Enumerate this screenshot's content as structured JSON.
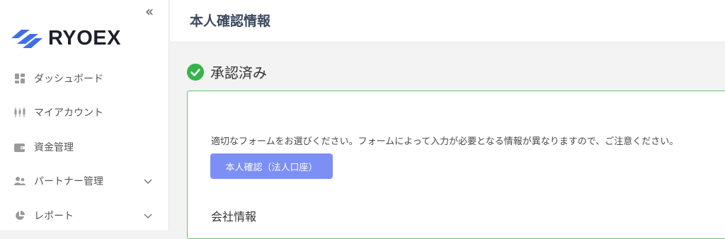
{
  "sidebar": {
    "collapse_icon": "double-chevron-left",
    "logo_text": "RYOEX",
    "brand_color": "#3f6ee8",
    "items": [
      {
        "label": "ダッシュボード",
        "icon": "dashboard-icon",
        "has_submenu": false
      },
      {
        "label": "マイアカウント",
        "icon": "candlestick-icon",
        "has_submenu": false
      },
      {
        "label": "資金管理",
        "icon": "wallet-icon",
        "has_submenu": false
      },
      {
        "label": "パートナー管理",
        "icon": "users-icon",
        "has_submenu": true
      },
      {
        "label": "レポート",
        "icon": "pie-chart-icon",
        "has_submenu": true
      }
    ]
  },
  "header": {
    "title": "本人確認情報"
  },
  "main": {
    "status": {
      "text": "承認済み",
      "color": "#34b44a"
    },
    "panel_border_color": "#6cc26a",
    "instruction": "適切なフォームをお選びください。フォームによって入力が必要となる情報が異なりますので、ご注意ください。",
    "corp_button_label": "本人確認（法人口座）",
    "corp_button_color": "#7c8ff4",
    "section_title": "会社情報"
  }
}
